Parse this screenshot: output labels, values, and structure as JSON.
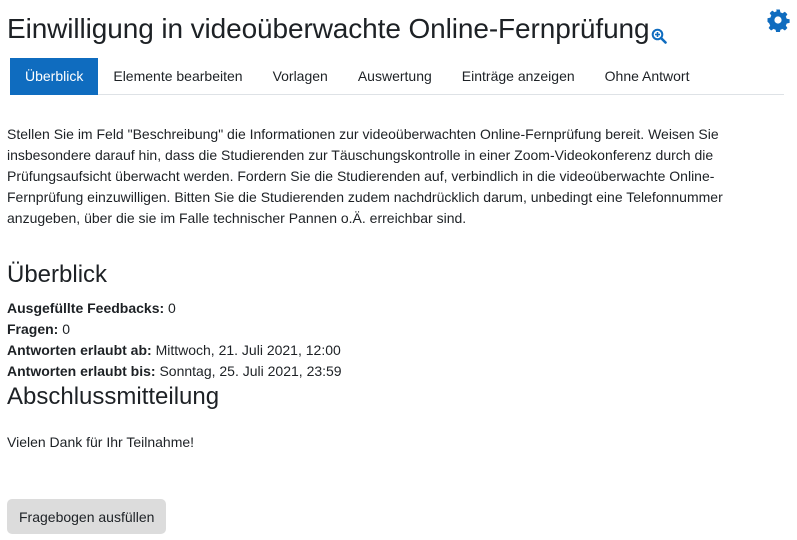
{
  "header": {
    "title": "Einwilligung in videoüberwachte Online-Fernprüfung",
    "zoom_icon": "zoom-in-icon",
    "settings_icon": "gear-icon",
    "accent_color": "#0f6cbf"
  },
  "tabs": [
    {
      "label": "Überblick",
      "active": true
    },
    {
      "label": "Elemente bearbeiten",
      "active": false
    },
    {
      "label": "Vorlagen",
      "active": false
    },
    {
      "label": "Auswertung",
      "active": false
    },
    {
      "label": "Einträge anzeigen",
      "active": false
    },
    {
      "label": "Ohne Antwort",
      "active": false
    }
  ],
  "main": {
    "intro": "Stellen Sie im Feld \"Beschreibung\" die Informationen zur videoüberwachten Online-Fernprüfung bereit. Weisen Sie insbesondere darauf hin, dass die Studierenden zur Täuschungskontrolle in einer Zoom-Videokonferenz durch die Prüfungsaufsicht überwacht werden. Fordern Sie die Studierenden auf, verbindlich in die videoüberwachte Online-Fernprüfung einzuwilligen. Bitten Sie die Studierenden zudem nachdrücklich darum, unbedingt eine Telefonnummer anzugeben, über die sie im Falle technischer Pannen o.Ä. erreichbar sind.",
    "overview_heading": "Überblick",
    "info": [
      {
        "label": "Ausgefüllte Feedbacks:",
        "value": "0"
      },
      {
        "label": "Fragen:",
        "value": "0"
      },
      {
        "label": "Antworten erlaubt ab:",
        "value": "Mittwoch, 21. Juli 2021, 12:00"
      },
      {
        "label": "Antworten erlaubt bis:",
        "value": "Sonntag, 25. Juli 2021, 23:59"
      }
    ],
    "completion_heading": "Abschlussmitteilung",
    "thanks": "Vielen Dank für Ihr Teilnahme!",
    "fill_button": "Fragebogen ausfüllen"
  }
}
